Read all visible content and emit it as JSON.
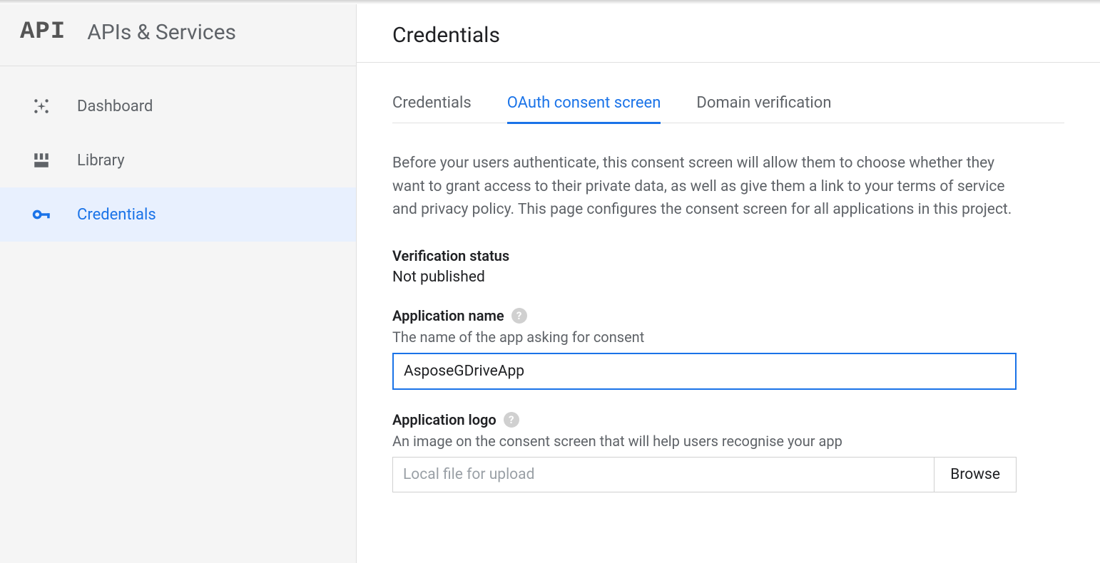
{
  "sidebar": {
    "logo_text": "API",
    "title": "APIs & Services",
    "items": [
      {
        "id": "dashboard",
        "label": "Dashboard",
        "icon": "dashboard-icon",
        "active": false
      },
      {
        "id": "library",
        "label": "Library",
        "icon": "library-icon",
        "active": false
      },
      {
        "id": "credentials",
        "label": "Credentials",
        "icon": "key-icon",
        "active": true
      }
    ]
  },
  "main": {
    "title": "Credentials",
    "tabs": [
      {
        "id": "credentials",
        "label": "Credentials",
        "active": false
      },
      {
        "id": "oauth",
        "label": "OAuth consent screen",
        "active": true
      },
      {
        "id": "domain",
        "label": "Domain verification",
        "active": false
      }
    ],
    "intro": "Before your users authenticate, this consent screen will allow them to choose whether they want to grant access to their private data, as well as give them a link to your terms of service and privacy policy. This page configures the consent screen for all applications in this project.",
    "verification": {
      "label": "Verification status",
      "value": "Not published"
    },
    "app_name": {
      "label": "Application name",
      "helper": "The name of the app asking for consent",
      "value": "AsposeGDriveApp"
    },
    "app_logo": {
      "label": "Application logo",
      "helper": "An image on the consent screen that will help users recognise your app",
      "placeholder": "Local file for upload",
      "browse_label": "Browse"
    }
  }
}
